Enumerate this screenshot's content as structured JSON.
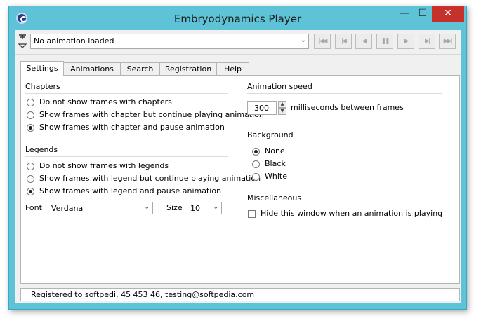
{
  "window": {
    "title": "Embryodynamics Player"
  },
  "toolbar": {
    "animation_select": "No animation loaded",
    "nav_buttons": [
      {
        "icon": "first-icon",
        "glyph": "|◀◀"
      },
      {
        "icon": "prev-chapter-icon",
        "glyph": "|◀"
      },
      {
        "icon": "step-back-icon",
        "glyph": "◀"
      },
      {
        "icon": "pause-icon",
        "glyph": "❚❚"
      },
      {
        "icon": "play-icon",
        "glyph": "▶"
      },
      {
        "icon": "next-chapter-icon",
        "glyph": "▶|"
      },
      {
        "icon": "last-icon",
        "glyph": "▶▶|"
      }
    ]
  },
  "tabs": [
    "Settings",
    "Animations",
    "Search",
    "Registration",
    "Help"
  ],
  "active_tab": "Settings",
  "chapters": {
    "title": "Chapters",
    "options": [
      "Do not show frames with chapters",
      "Show frames with chapter but continue playing animation",
      "Show frames with chapter and pause animation"
    ],
    "selected": 2
  },
  "legends": {
    "title": "Legends",
    "options": [
      "Do not show frames with legends",
      "Show frames with legend but continue playing animation",
      "Show frames with legend and pause animation"
    ],
    "selected": 2,
    "font_label": "Font",
    "font_value": "Verdana",
    "size_label": "Size",
    "size_value": "10"
  },
  "speed": {
    "title": "Animation speed",
    "value": "300",
    "unit_label": "milliseconds between frames"
  },
  "background": {
    "title": "Background",
    "options": [
      "None",
      "Black",
      "White"
    ],
    "selected": 0
  },
  "misc": {
    "title": "Miscellaneous",
    "hide_label": "Hide this window when an animation is playing",
    "hide_checked": false
  },
  "status": "Registered to softpedi, 45 453 46, testing@softpedia.com"
}
